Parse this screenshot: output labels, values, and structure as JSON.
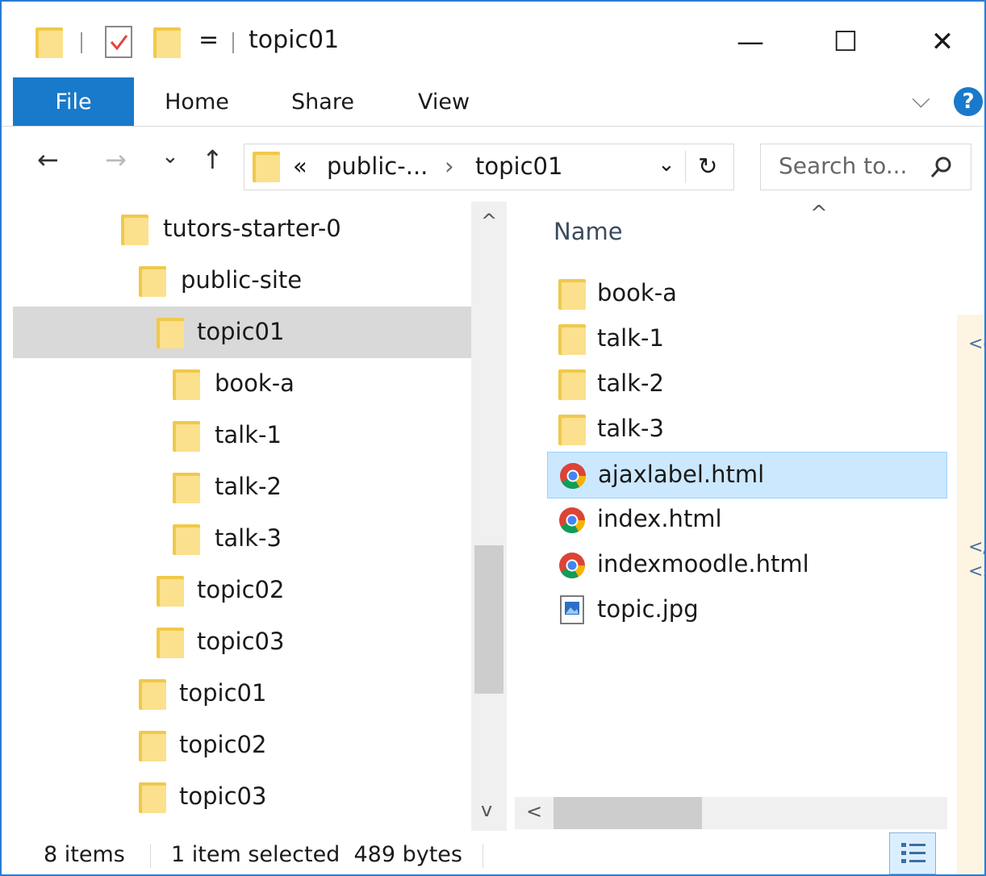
{
  "window": {
    "title": "topic01",
    "minimize_glyph": "—",
    "maximize_glyph": "☐",
    "close_glyph": "✕",
    "qat_dropdown_glyph": "="
  },
  "ribbon": {
    "tabs": [
      "File",
      "Home",
      "Share",
      "View"
    ],
    "collapse_glyph": "⌵",
    "help_glyph": "?"
  },
  "navbar": {
    "back_glyph": "←",
    "forward_glyph": "→",
    "recent_glyph": "⌄",
    "up_glyph": "↑",
    "overflow_glyph": "«",
    "breadcrumb": [
      "public-...",
      "topic01"
    ],
    "crumb_sep_glyph": "›",
    "dropdown_glyph": "⌄",
    "refresh_glyph": "↻",
    "search_placeholder": "Search to...",
    "search_glyph": "⚲"
  },
  "tree": {
    "items": [
      {
        "label": "tutors-starter-0"
      },
      {
        "label": "public-site"
      },
      {
        "label": "topic01"
      },
      {
        "label": "book-a"
      },
      {
        "label": "talk-1"
      },
      {
        "label": "talk-2"
      },
      {
        "label": "talk-3"
      },
      {
        "label": "topic02"
      },
      {
        "label": "topic03"
      },
      {
        "label": "topic01"
      },
      {
        "label": "topic02"
      },
      {
        "label": "topic03"
      }
    ],
    "scroll_up_glyph": "^",
    "scroll_down_glyph": "v"
  },
  "list": {
    "column_name": "Name",
    "sort_glyph": "^",
    "rows": [
      {
        "label": "book-a",
        "icon": "folder-icon"
      },
      {
        "label": "talk-1",
        "icon": "folder-icon"
      },
      {
        "label": "talk-2",
        "icon": "folder-icon"
      },
      {
        "label": "talk-3",
        "icon": "folder-icon"
      },
      {
        "label": "ajaxlabel.html",
        "icon": "chrome-icon"
      },
      {
        "label": "index.html",
        "icon": "chrome-icon"
      },
      {
        "label": "indexmoodle.html",
        "icon": "chrome-icon"
      },
      {
        "label": "topic.jpg",
        "icon": "image-file-icon"
      }
    ],
    "scroll_left_glyph": "<"
  },
  "preview": {
    "lines": [
      "<c",
      "</",
      "<s"
    ]
  },
  "status": {
    "items_count": "8 items",
    "selection": "1 item selected  489 bytes"
  },
  "colors": {
    "accent": "#1979ca",
    "folder": "#f0c94a",
    "selected_row": "#cce8ff",
    "selected_tree": "#d9d9d9"
  }
}
